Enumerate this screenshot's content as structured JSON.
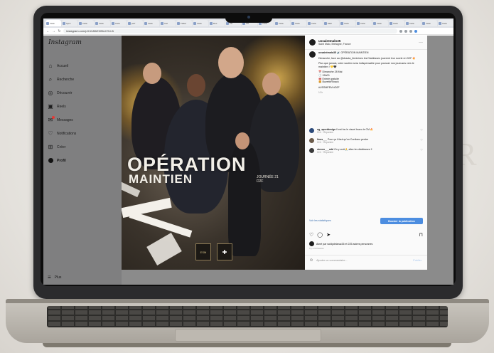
{
  "browser": {
    "tabs": [
      "Insta",
      "Sync",
      "Insta",
      "Insta",
      "Insta",
      "perf",
      "Insta",
      "Inst",
      "Ticket",
      "Insta",
      "Doc",
      "Ins",
      "Ins",
      "Insta",
      "Insta",
      "Insta",
      "Insta",
      "Mail",
      "Insta",
      "Insta",
      "Insta",
      "Insta",
      "Insta",
      "Insta",
      "Insta",
      "Insta"
    ],
    "url": "instagram.com/p/C2z5lhEN9hU/?hl=fr"
  },
  "sidebar": {
    "logo": "Instagram",
    "items": [
      {
        "label": "Accueil",
        "icon": "home-icon"
      },
      {
        "label": "Recherche",
        "icon": "search-icon"
      },
      {
        "label": "Découvrir",
        "icon": "compass-icon"
      },
      {
        "label": "Reels",
        "icon": "reels-icon"
      },
      {
        "label": "Messages",
        "icon": "messenger-icon"
      },
      {
        "label": "Notifications",
        "icon": "heart-icon"
      },
      {
        "label": "Créer",
        "icon": "plus-square-icon"
      },
      {
        "label": "Profil",
        "icon": "avatar-icon"
      }
    ],
    "more": "Plus"
  },
  "post": {
    "title_line1": "OPÉRATION",
    "title_line2": "MAINTIEN",
    "journee": "JOURNÉE 21\nD2F",
    "badge": "ESM"
  },
  "panel": {
    "username": "ussaintmalo35",
    "location": "Saint Malo, Bretagne, France",
    "caption_user": "ussaintmalo35",
    "caption_title": "OPÉRATION MAINTIEN",
    "caption_p1": "Dimanche, face au @chauta_feminines les Diablesses jouerent leur survie en D2F 🔥",
    "caption_p2": "Plus que jamais, votre soutien sera indispensable pour pousser nos joueuses vers le maintien ! 💛🖤",
    "caption_list": [
      "📅 Dimanche 28 Mai",
      "🕒 15h00",
      "🎟️ Entrée gratuite",
      "🍔 Buvette/Snack"
    ],
    "caption_tags": "#USSMFEM #D2F",
    "caption_time": "10 h",
    "comments": [
      {
        "user": "og_sportdesign",
        "text": "Il est fou le visuel bravo le CM 🔥",
        "meta": "10 h · Répondre"
      },
      {
        "user": "linus___",
        "text": "Pour ça il faut qu'on Cordiano perdre",
        "meta": "10 h · Répondre"
      },
      {
        "user": "steven___mbl",
        "text": "On y croit🙏 allez les diablesses !!",
        "meta": "10 h · Répondre"
      }
    ],
    "stats_link": "Voir les statistiques",
    "boost": "Booster la publication",
    "likes": "Aimé par soldydelaruz26 et 225 autres personnes",
    "date": "Il y a 10 heures",
    "add_comment": "Ajouter un commentaire...",
    "publish": "Publier"
  }
}
